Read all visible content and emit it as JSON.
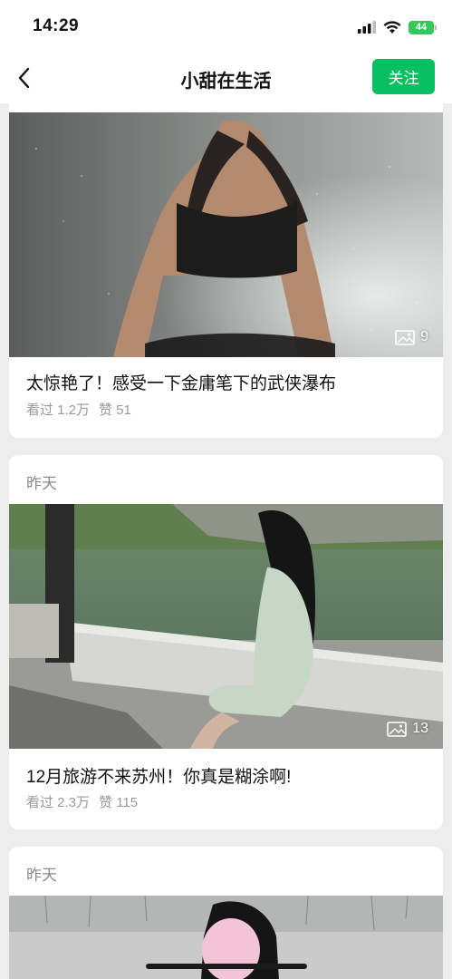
{
  "status_bar": {
    "time": "14:29",
    "battery": "44"
  },
  "nav": {
    "title": "小甜在生活",
    "follow_label": "关注"
  },
  "posts": [
    {
      "date": "",
      "image_count": "9",
      "title": "太惊艳了！感受一下金庸笔下的武侠瀑布",
      "views": "看过 1.2万",
      "likes": "赞 51"
    },
    {
      "date": "昨天",
      "image_count": "13",
      "title": "12月旅游不来苏州！你真是糊涂啊!",
      "views": "看过 2.3万",
      "likes": "赞 115"
    },
    {
      "date": "昨天"
    }
  ],
  "colors": {
    "accent": "#07c160",
    "background": "#ededed",
    "meta_text": "#9a9a9a"
  }
}
